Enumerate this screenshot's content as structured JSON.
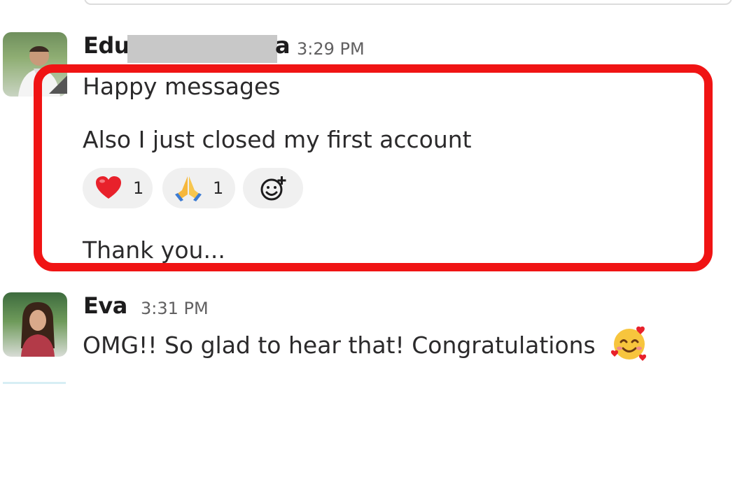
{
  "messages": [
    {
      "sender_partial": "Edu",
      "sender_trailing": "a",
      "time": "3:29 PM",
      "lines": [
        "Happy messages",
        "Also I just closed my first account",
        "Thank you..."
      ],
      "reactions": [
        {
          "emoji_name": "red-heart",
          "count": "1"
        },
        {
          "emoji_name": "folded-hands",
          "count": "1"
        }
      ],
      "add_reaction_icon": "add-reaction-icon"
    },
    {
      "sender": "Eva",
      "time": "3:31 PM",
      "text": "OMG!! So glad to hear that! Congratulations",
      "trailing_emoji": "smiling-face-with-hearts"
    }
  ],
  "colors": {
    "highlight": "#f01414",
    "reaction_bg": "#f0f0f0"
  }
}
